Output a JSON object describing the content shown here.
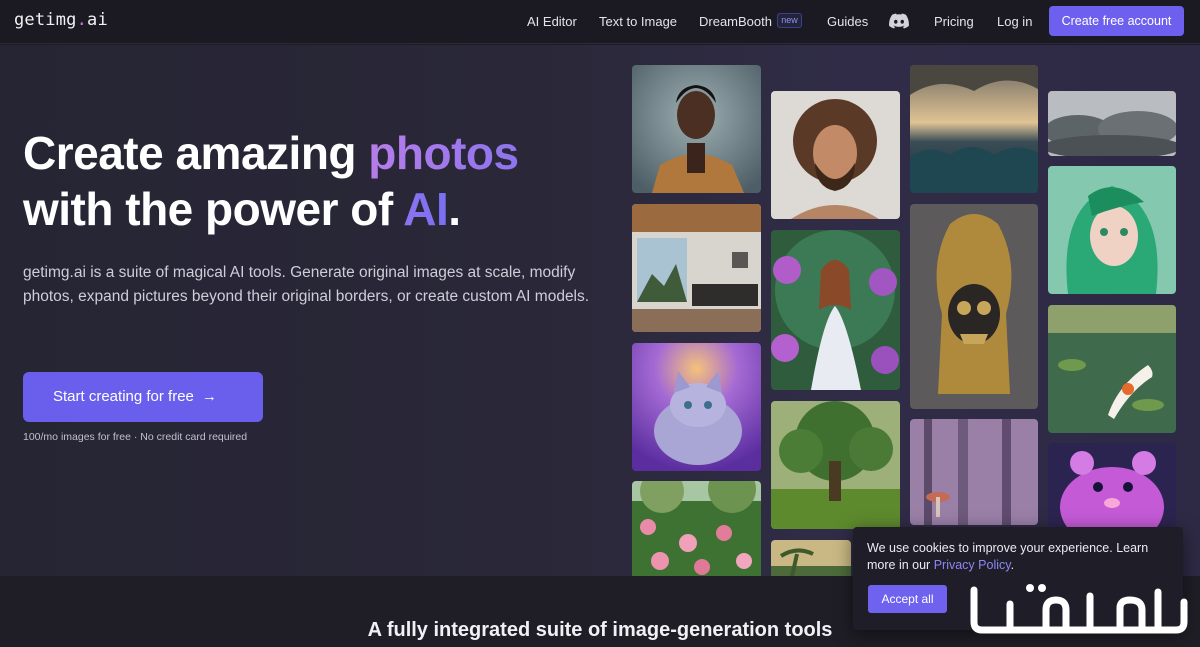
{
  "nav": {
    "logo_main": "getimg",
    "logo_dot": ".",
    "logo_tld": "ai",
    "links": [
      "AI Editor",
      "Text to Image",
      "DreamBooth",
      "Guides",
      "Pricing",
      "Log in"
    ],
    "new_badge": "new",
    "discord_icon": "discord-icon",
    "cta": "Create free account"
  },
  "hero": {
    "title_part1": "Create amazing ",
    "title_highlight1": "photos",
    "title_part2": "with the power of ",
    "title_highlight2": "AI",
    "title_end": ".",
    "description": "getimg.ai is a suite of magical AI tools. Generate original images at scale, modify photos, expand pictures beyond their original borders, or create custom AI models.",
    "cta": "Start creating for free",
    "cta_icon": "arrow-right-icon",
    "note": "100/mo images for free · No credit card required"
  },
  "gallery": [
    "portrait-man-image",
    "curly-hair-man-image",
    "stormy-sea-image",
    "clouds-image",
    "bedroom-interior-image",
    "flower-goddess-image",
    "golden-skull-image",
    "green-hair-anime-girl-image",
    "galaxy-cat-image",
    "forest-tree-image",
    "koi-pond-image",
    "rose-garden-image",
    "misty-forest-mushroom-image",
    "neon-hamster-image",
    "palm-tree-image"
  ],
  "section": {
    "subheading": "A fully integrated suite of image-generation tools"
  },
  "cookie": {
    "text": "We use cookies to improve your experience. Learn more in our ",
    "link": "Privacy Policy",
    "period": ".",
    "accept": "Accept all"
  },
  "watermark": {
    "text": "مستعمل"
  },
  "colors": {
    "accent": "#6e60ee",
    "gradient_start": "#b77de8",
    "background": "#1d1b26"
  }
}
